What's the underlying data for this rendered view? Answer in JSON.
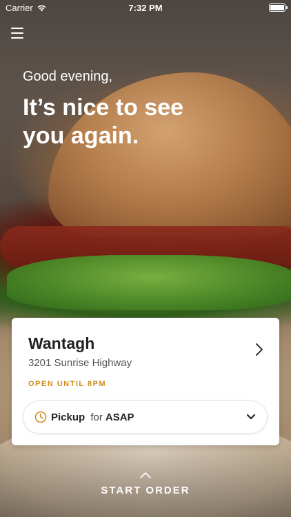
{
  "status_bar": {
    "carrier": "Carrier",
    "time": "7:32 PM",
    "battery_level": 1.0
  },
  "header": {
    "greeting": "Good evening,",
    "headline": "It’s nice to see you again."
  },
  "store": {
    "name": "Wantagh",
    "address": "3201 Sunrise Highway",
    "hours": "OPEN UNTIL 8PM",
    "hours_color": "#d08a1a"
  },
  "order_mode": {
    "mode": "Pickup",
    "connector": "for",
    "time": "ASAP"
  },
  "cta": {
    "label": "START ORDER"
  },
  "icons": {
    "menu": "hamburger-menu-icon",
    "wifi": "wifi-icon",
    "battery": "battery-icon",
    "store_chevron": "chevron-right-icon",
    "clock": "clock-icon",
    "dropdown": "chevron-down-icon",
    "start": "chevron-up-icon"
  }
}
